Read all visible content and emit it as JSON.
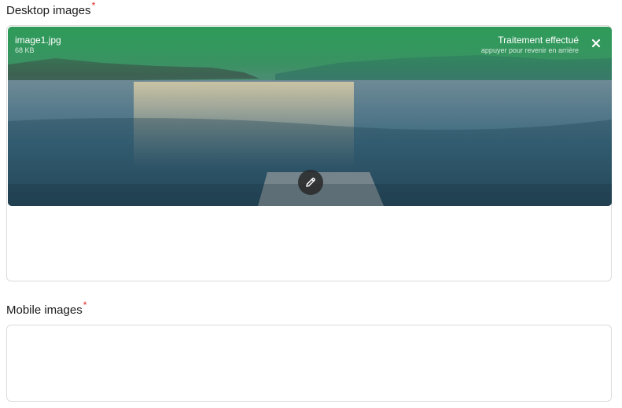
{
  "desktop": {
    "label": "Desktop images",
    "required_mark": "*",
    "file": {
      "name": "image1.jpg",
      "size": "68 KB"
    },
    "status": {
      "title": "Traitement effectué",
      "subtitle": "appuyer pour revenir en arrière"
    },
    "remove_icon": "close-icon",
    "edit_icon": "pencil-icon"
  },
  "mobile": {
    "label": "Mobile images",
    "required_mark": "*"
  },
  "colors": {
    "required": "#e02424",
    "overlay_top": "#2f9a5a",
    "border": "#dcdcdc"
  }
}
